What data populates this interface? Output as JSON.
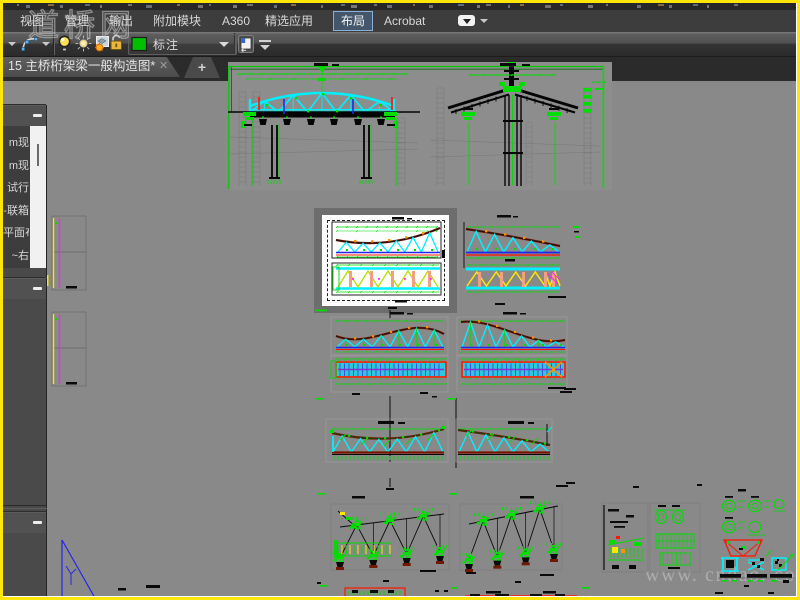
{
  "window": {
    "frame_color": "#ffe60a",
    "canvas_background": "#898989"
  },
  "top_menu": {
    "tabs": [
      {
        "label": "视图",
        "selected": false
      },
      {
        "label": "管理",
        "selected": false
      },
      {
        "label": "输出",
        "selected": false
      },
      {
        "label": "附加模块",
        "selected": false
      },
      {
        "label": "A360",
        "selected": false
      },
      {
        "label": "精选应用",
        "selected": false
      },
      {
        "label": "布局",
        "selected": true
      },
      {
        "label": "Acrobat",
        "selected": false
      }
    ]
  },
  "toolbar": {
    "layer_swatch_color": "#00c000",
    "layer_name": "标注",
    "icons": [
      "dropdown-caret",
      "spline",
      "dropdown-caret",
      "layer-on-bulb",
      "layer-thaw-sun",
      "layer-isolate",
      "unlock",
      "layer-color-swatch",
      "combo-caret",
      "layer-properties",
      "ribbon-collapse-chevron"
    ]
  },
  "file_tabs": {
    "active_tab": "15 主桥桁架梁一般构造图*",
    "close_label": "✕",
    "new_tab_label": "+"
  },
  "sidebar": {
    "list_items": [
      "m现",
      "m现",
      "试行",
      "-联箱",
      "平面布",
      "~右"
    ]
  },
  "watermarks": {
    "site_logo": "道桥网",
    "site_url": "www. cndao. com"
  }
}
